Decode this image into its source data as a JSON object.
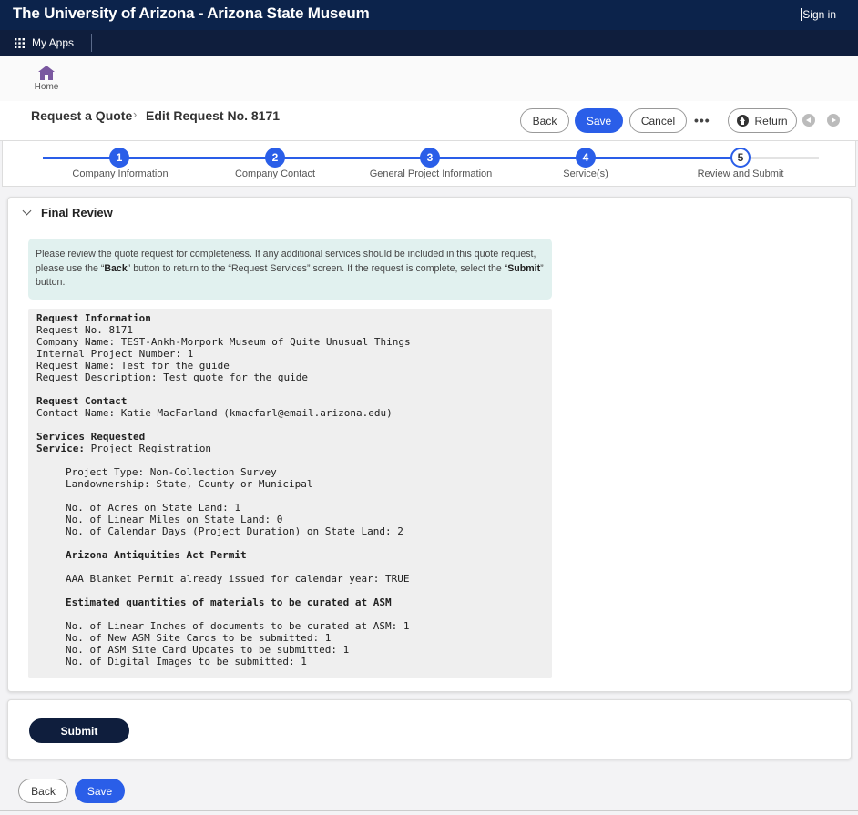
{
  "topbar": {
    "title": "The University of Arizona - Arizona State Museum",
    "signin": "Sign in"
  },
  "appbar": {
    "my_apps": "My Apps",
    "grid_icon": "grid-icon"
  },
  "home": {
    "label": "Home",
    "icon": "home-icon",
    "icon_color": "#7a58a0"
  },
  "breadcrumb": {
    "first": "Request a Quote",
    "separator": "›",
    "second": "Edit Request No. 8171"
  },
  "toolbar": {
    "back": "Back",
    "save": "Save",
    "cancel": "Cancel",
    "more": "•••",
    "return": "Return"
  },
  "steps": [
    {
      "number": "1",
      "label": "Company Information"
    },
    {
      "number": "2",
      "label": "Company Contact"
    },
    {
      "number": "3",
      "label": "General Project Information"
    },
    {
      "number": "4",
      "label": "Service(s)"
    },
    {
      "number": "5",
      "label": "Review and Submit"
    }
  ],
  "active_step": 5,
  "final_review": {
    "title": "Final Review",
    "notice": {
      "p1": "Please review the quote request for completeness. If any additional services should be included in this quote request, please use the “",
      "back": "Back",
      "p2": "” button to return to the “Request Services” screen. If the request is complete, select the “",
      "submit": "Submit",
      "p3": "” button."
    },
    "request_information": {
      "heading": "Request Information",
      "lines": [
        "Request No. 8171",
        "Company Name: TEST-Ankh-Morpork Museum of Quite Unusual Things",
        "Internal Project Number: 1",
        "Request Name: Test for the guide",
        "Request Description: Test quote for the guide"
      ]
    },
    "request_contact": {
      "heading": "Request Contact",
      "lines": [
        "Contact Name: Katie MacFarland (kmacfarl@email.arizona.edu)"
      ]
    },
    "services": {
      "heading": "Services Requested",
      "service_label": "Service:",
      "service_value": " Project Registration",
      "block1": [
        "Project Type: Non-Collection Survey",
        "Landownership: State, County or Municipal"
      ],
      "block2": [
        "No. of Acres on State Land: 1",
        "No. of Linear Miles on State Land: 0",
        "No. of Calendar Days (Project Duration) on State Land: 2"
      ],
      "permit_heading": "Arizona Antiquities Act Permit",
      "permit_lines": [
        "AAA Blanket Permit already issued for calendar year: TRUE"
      ],
      "materials_heading": "Estimated quantities of materials to be curated at ASM",
      "materials_lines": [
        "No. of Linear Inches of documents to be curated at ASM: 1",
        "No. of New ASM Site Cards to be submitted: 1",
        "No. of ASM Site Card Updates to be submitted: 1",
        "No. of Digital Images to be submitted: 1"
      ]
    }
  },
  "submit_label": "Submit",
  "footer": {
    "back": "Back",
    "save": "Save"
  },
  "colors": {
    "navy": "#0c234b",
    "primary": "#2a5ee8",
    "notice_bg": "#e1f1ef"
  }
}
